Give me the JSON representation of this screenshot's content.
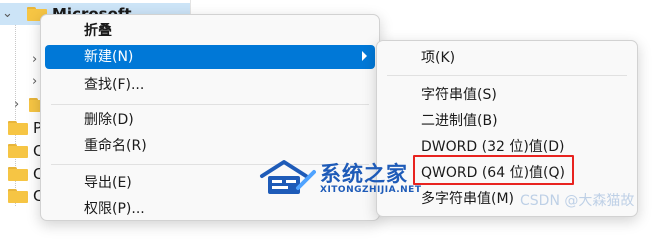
{
  "tree": {
    "rows": [
      {
        "label": "Microsoft",
        "expanded": true
      },
      {
        "label": ""
      },
      {
        "label": ""
      },
      {
        "label": ""
      },
      {
        "label": ""
      },
      {
        "label": "P"
      },
      {
        "label": "C"
      },
      {
        "label": "C"
      },
      {
        "label": "C"
      }
    ]
  },
  "context_menu": {
    "items": [
      {
        "label": "折叠"
      },
      {
        "label": "新建(N)"
      },
      {
        "label": "查找(F)..."
      },
      {
        "label": "删除(D)"
      },
      {
        "label": "重命名(R)"
      },
      {
        "label": "导出(E)"
      },
      {
        "label": "权限(P)..."
      }
    ]
  },
  "submenu": {
    "items": [
      {
        "label": "项(K)"
      },
      {
        "label": "字符串值(S)"
      },
      {
        "label": "二进制值(B)"
      },
      {
        "label": "DWORD (32 位)值(D)"
      },
      {
        "label": "QWORD (64 位)值(Q)"
      },
      {
        "label": "多字符串值(M)"
      }
    ]
  },
  "watermark": {
    "title": "系统之家",
    "subtitle": "XITONGZHIJIA.NET",
    "faint": "CSDN @大森猫故"
  },
  "colors": {
    "highlight": "#0078d7",
    "red_box": "#e8231f",
    "folder": "#f6c544",
    "watermark": "#1e5bb8"
  },
  "icons": {
    "tree_folder": "folder-icon",
    "submenu_arrow": "chevron-right-icon",
    "watermark_logo": "house-logo-icon"
  }
}
